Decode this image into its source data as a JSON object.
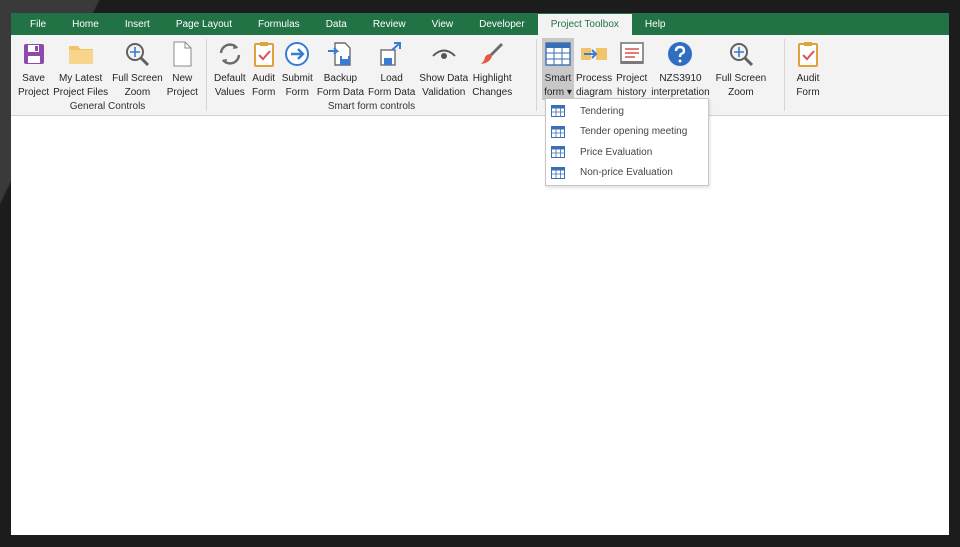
{
  "menu": {
    "tabs": [
      "File",
      "Home",
      "Insert",
      "Page Layout",
      "Formulas",
      "Data",
      "Review",
      "View",
      "Developer",
      "Project Toolbox",
      "Help"
    ],
    "active_tab": "Project Toolbox"
  },
  "ribbon": {
    "general": {
      "label": "General Controls",
      "buttons": [
        {
          "line1": "Save",
          "line2": "Project",
          "icon": "save-icon"
        },
        {
          "line1": "My Latest",
          "line2": "Project Files",
          "icon": "folder-icon"
        },
        {
          "line1": "Full Screen",
          "line2": "Zoom",
          "icon": "zoom-icon"
        },
        {
          "line1": "New",
          "line2": "Project",
          "icon": "new-page-icon"
        }
      ]
    },
    "smart": {
      "label": "Smart form controls",
      "buttons": [
        {
          "line1": "Default",
          "line2": "Values",
          "icon": "refresh-icon"
        },
        {
          "line1": "Audit",
          "line2": "Form",
          "icon": "clipboard-check-icon"
        },
        {
          "line1": "Submit",
          "line2": "Form",
          "icon": "arrow-right-circle-icon"
        },
        {
          "line1": "Backup",
          "line2": "Form Data",
          "icon": "backup-icon"
        },
        {
          "line1": "Load",
          "line2": "Form Data",
          "icon": "load-icon"
        },
        {
          "line1": "Show Data",
          "line2": "Validation",
          "icon": "eye-icon"
        },
        {
          "line1": "Highlight",
          "line2": "Changes",
          "icon": "brush-icon"
        }
      ]
    },
    "forms": {
      "buttons": [
        {
          "line1": "Smart",
          "line2": "form ▾",
          "icon": "table-icon"
        },
        {
          "line1": "Process",
          "line2": "diagram",
          "icon": "process-icon"
        },
        {
          "line1": "Project",
          "line2": "history",
          "icon": "history-icon"
        },
        {
          "line1": "NZS3910",
          "line2": "interpretation",
          "icon": "help-icon"
        },
        {
          "line1": "Full Screen",
          "line2": "Zoom",
          "icon": "zoom-icon"
        }
      ]
    },
    "audit": {
      "buttons": [
        {
          "line1": "Audit",
          "line2": "Form",
          "icon": "clipboard-check-icon"
        }
      ]
    }
  },
  "dropdown": {
    "items": [
      "Tendering",
      "Tender opening meeting",
      "Price Evaluation",
      "Non-price Evaluation"
    ]
  },
  "colors": {
    "menubar": "#217346",
    "ribbon": "#f3f3f3",
    "accent_blue": "#3a7bd5",
    "purple": "#7c3d96"
  }
}
